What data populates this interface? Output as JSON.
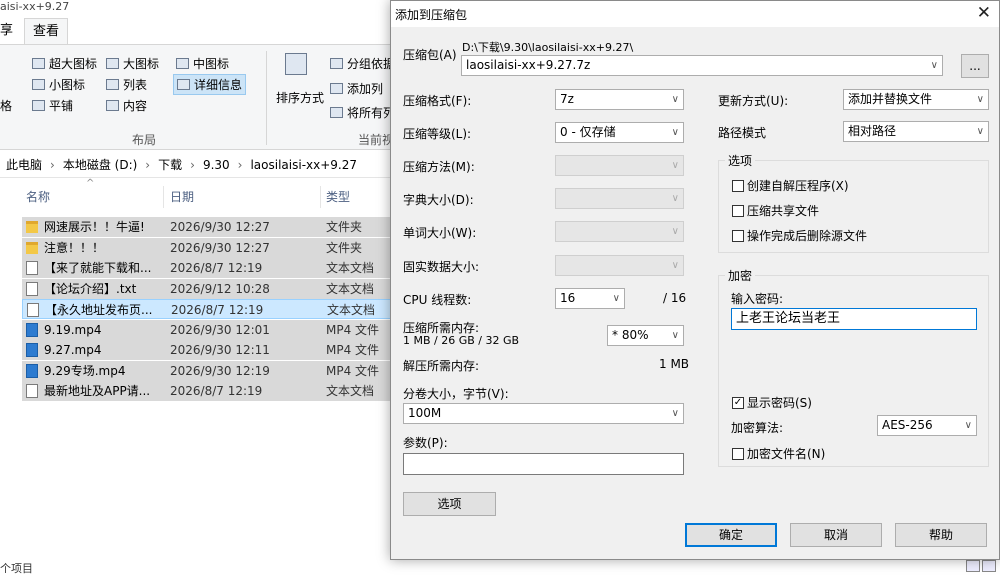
{
  "explorer": {
    "title_fragment": "aisi-xx+9.27",
    "tabs": [
      "享",
      "查看"
    ],
    "ribbon": {
      "layout_items": [
        "超大图标",
        "大图标",
        "中图标",
        "小图标",
        "列表",
        "详细信息",
        "平铺",
        "内容"
      ],
      "left_fragment": "格",
      "sort_label": "排序方式",
      "current_items": [
        "分组依据",
        "添加列",
        "将所有列"
      ],
      "group_layout": "布局",
      "group_current": "当前视"
    },
    "breadcrumb": [
      "此电脑",
      "本地磁盘 (D:)",
      "下载",
      "9.30",
      "laosilaisi-xx+9.27"
    ],
    "columns": {
      "name": "名称",
      "date": "日期",
      "type": "类型"
    },
    "files": [
      {
        "name": "网速展示！！牛逼!",
        "date": "2026/9/30 12:27",
        "type": "文件夹",
        "icon": "folder"
      },
      {
        "name": "注意！！！",
        "date": "2026/9/30 12:27",
        "type": "文件夹",
        "icon": "folder"
      },
      {
        "name": "【来了就能下载和...",
        "date": "2026/8/7 12:19",
        "type": "文本文档",
        "icon": "doc"
      },
      {
        "name": "【论坛介绍】.txt",
        "date": "2026/9/12 10:28",
        "type": "文本文档",
        "icon": "doc"
      },
      {
        "name": "【永久地址发布页...",
        "date": "2026/8/7 12:19",
        "type": "文本文档",
        "icon": "doc"
      },
      {
        "name": "9.19.mp4",
        "date": "2026/9/30 12:01",
        "type": "MP4 文件",
        "icon": "mp4"
      },
      {
        "name": "9.27.mp4",
        "date": "2026/9/30 12:11",
        "type": "MP4 文件",
        "icon": "mp4"
      },
      {
        "name": "9.29专场.mp4",
        "date": "2026/9/30 12:19",
        "type": "MP4 文件",
        "icon": "mp4"
      },
      {
        "name": "最新地址及APP请...",
        "date": "2026/8/7 12:19",
        "type": "文本文档",
        "icon": "doc"
      }
    ],
    "selected_row": 4,
    "status": "个项目"
  },
  "dialog": {
    "title": "添加到压缩包",
    "archive_label": "压缩包(A)",
    "archive_path": "D:\\下载\\9.30\\laosilaisi-xx+9.27\\",
    "archive_name": "laosilaisi-xx+9.27.7z",
    "browse": "...",
    "format_label": "压缩格式(F):",
    "format_value": "7z",
    "level_label": "压缩等级(L):",
    "level_value": "0 - 仅存储",
    "method_label": "压缩方法(M):",
    "dict_label": "字典大小(D):",
    "word_label": "单词大小(W):",
    "solid_label": "固实数据大小:",
    "threads_label": "CPU 线程数:",
    "threads_value": "16",
    "threads_total": "/ 16",
    "mem_comp_label": "压缩所需内存:",
    "mem_comp_value": "1 MB / 26 GB / 32 GB",
    "mem_pct": "* 80%",
    "mem_decomp_label": "解压所需内存:",
    "mem_decomp_value": "1 MB",
    "split_label": "分卷大小，字节(V):",
    "split_value": "100M",
    "params_label": "参数(P):",
    "options_button": "选项",
    "update_label": "更新方式(U):",
    "update_value": "添加并替换文件",
    "pathmode_label": "路径模式",
    "pathmode_value": "相对路径",
    "options_group": "选项",
    "opt_sfx": "创建自解压程序(X)",
    "opt_shared": "压缩共享文件",
    "opt_delete": "操作完成后删除源文件",
    "encrypt_group": "加密",
    "password_label": "输入密码:",
    "password_value": "上老王论坛当老王",
    "show_password": "显示密码(S)",
    "enc_method_label": "加密算法:",
    "enc_method_value": "AES-256",
    "encrypt_names": "加密文件名(N)",
    "ok": "确定",
    "cancel": "取消",
    "help": "帮助"
  }
}
